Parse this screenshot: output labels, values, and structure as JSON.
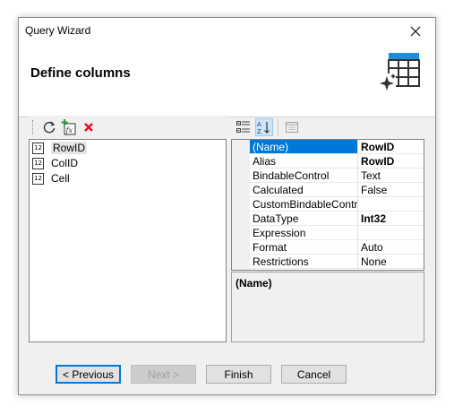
{
  "window": {
    "title": "Query Wizard"
  },
  "header": {
    "title": "Define columns"
  },
  "columns": [
    {
      "label": "RowID",
      "type_badge": "12"
    },
    {
      "label": "ColID",
      "type_badge": "12"
    },
    {
      "label": "Cell",
      "type_badge": "12"
    }
  ],
  "properties": [
    {
      "name": "(Name)",
      "value": "RowID",
      "bold": true
    },
    {
      "name": "Alias",
      "value": "RowID",
      "bold": true
    },
    {
      "name": "BindableControl",
      "value": "Text",
      "bold": false
    },
    {
      "name": "Calculated",
      "value": "False",
      "bold": false
    },
    {
      "name": "CustomBindableControl",
      "value": "",
      "bold": false
    },
    {
      "name": "DataType",
      "value": "Int32",
      "bold": true
    },
    {
      "name": "Expression",
      "value": "",
      "bold": false
    },
    {
      "name": "Format",
      "value": "Auto",
      "bold": false
    },
    {
      "name": "Restrictions",
      "value": "None",
      "bold": false
    }
  ],
  "description": {
    "title": "(Name)"
  },
  "buttons": {
    "previous": "< Previous",
    "next": "Next >",
    "finish": "Finish",
    "cancel": "Cancel"
  },
  "colors": {
    "accent": "#0078d7",
    "delete": "#e81123"
  }
}
